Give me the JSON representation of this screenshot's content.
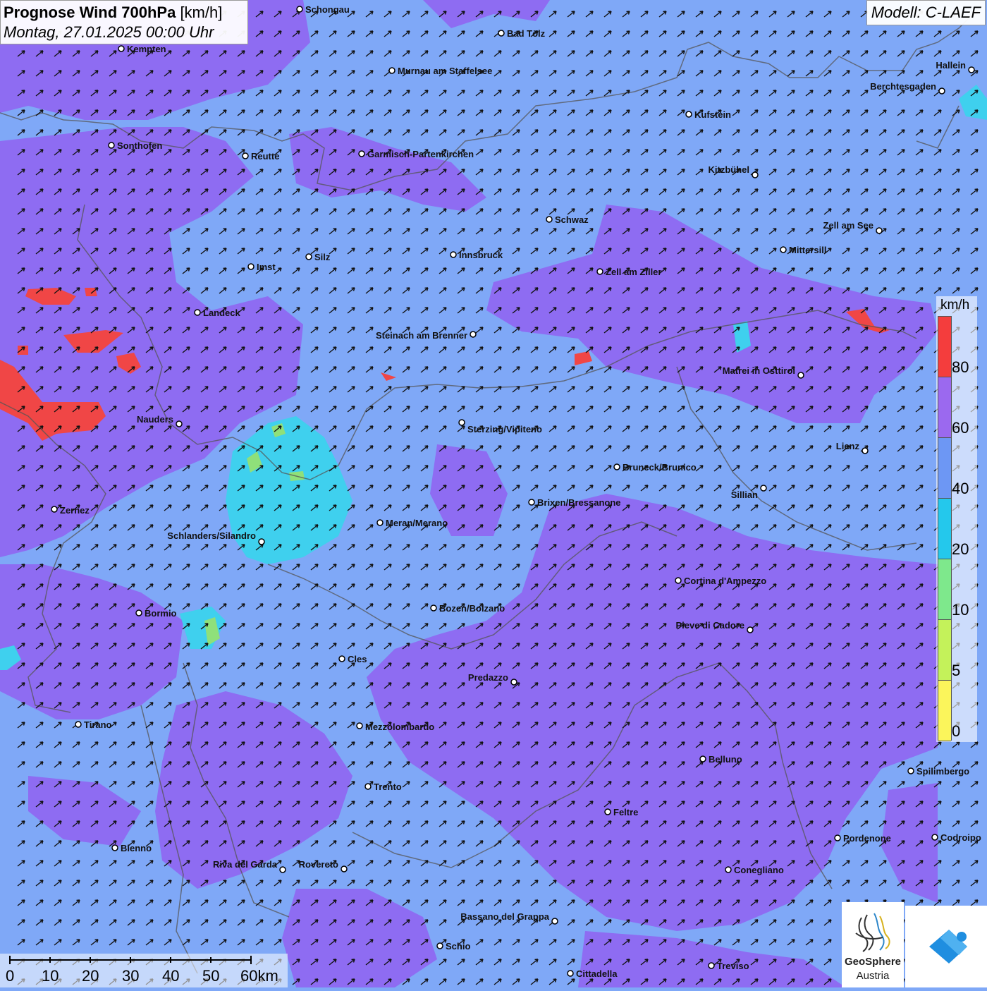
{
  "title": {
    "bold": "Prognose Wind 700hPa",
    "unit": "[km/h]",
    "date": "Montag, 27.01.2025 00:00 Uhr"
  },
  "model": "Modell: C-LAEF",
  "legend": {
    "unit": "km/h",
    "classes": [
      {
        "label": "80",
        "color": "#f43d3d"
      },
      {
        "label": "60",
        "color": "#9b69ef"
      },
      {
        "label": "40",
        "color": "#6d97f4"
      },
      {
        "label": "20",
        "color": "#24c8ec"
      },
      {
        "label": "10",
        "color": "#7ee88c"
      },
      {
        "label": "5",
        "color": "#c4f25a"
      },
      {
        "label": "0",
        "color": "#fbf55b"
      }
    ],
    "top_class_color": "#f43d3d"
  },
  "scale": {
    "labels": [
      "0",
      "10",
      "20",
      "30",
      "40",
      "50",
      "60km"
    ]
  },
  "logo": {
    "org_line1": "GeoSphere",
    "org_line2": "Austria"
  },
  "colors": {
    "purple": "#8e6cf2",
    "blue": "#7fa8f7",
    "cyan": "#3fd0ee",
    "red": "#f04646",
    "green": "#8fe07a"
  },
  "cities": [
    {
      "name": "Schongau"
    },
    {
      "name": "Bad Tölz"
    },
    {
      "name": "Kempten"
    },
    {
      "name": "Murnau am Staffelsee"
    },
    {
      "name": "Hallein"
    },
    {
      "name": "Berchtesgaden"
    },
    {
      "name": "Kufstein"
    },
    {
      "name": "Sonthofen"
    },
    {
      "name": "Reutte"
    },
    {
      "name": "Garmisch-Partenkirchen"
    },
    {
      "name": "Kitzbühel"
    },
    {
      "name": "Schwaz"
    },
    {
      "name": "Zell am See"
    },
    {
      "name": "Mittersill"
    },
    {
      "name": "Innsbruck"
    },
    {
      "name": "Silz"
    },
    {
      "name": "Imst"
    },
    {
      "name": "Zell am Ziller"
    },
    {
      "name": "Landeck"
    },
    {
      "name": "Steinach am Brenner"
    },
    {
      "name": "Matrei in Osttirol"
    },
    {
      "name": "Nauders"
    },
    {
      "name": "Sterzing/Vipiteno"
    },
    {
      "name": "Lienz"
    },
    {
      "name": "Bruneck/Brunico"
    },
    {
      "name": "Sillian"
    },
    {
      "name": "Zernez"
    },
    {
      "name": "Brixen/Bressanone"
    },
    {
      "name": "Meran/Merano"
    },
    {
      "name": "Schlanders/Silandro"
    },
    {
      "name": "Cortina d'Ampezzo"
    },
    {
      "name": "Bozen/Bolzano"
    },
    {
      "name": "Bormio"
    },
    {
      "name": "Pieve di Cadore"
    },
    {
      "name": "Cles"
    },
    {
      "name": "Predazzo"
    },
    {
      "name": "Tirano"
    },
    {
      "name": "Mezzolombardo"
    },
    {
      "name": "Belluno"
    },
    {
      "name": "Spilimbergo"
    },
    {
      "name": "Trento"
    },
    {
      "name": "Feltre"
    },
    {
      "name": "Pordenone"
    },
    {
      "name": "Codroipo"
    },
    {
      "name": "Bienno"
    },
    {
      "name": "Riva del Garda"
    },
    {
      "name": "Rovereto"
    },
    {
      "name": "Conegliano"
    },
    {
      "name": "Bassano del Grappa"
    },
    {
      "name": "Schio"
    },
    {
      "name": "Treviso"
    },
    {
      "name": "Cittadella"
    }
  ]
}
